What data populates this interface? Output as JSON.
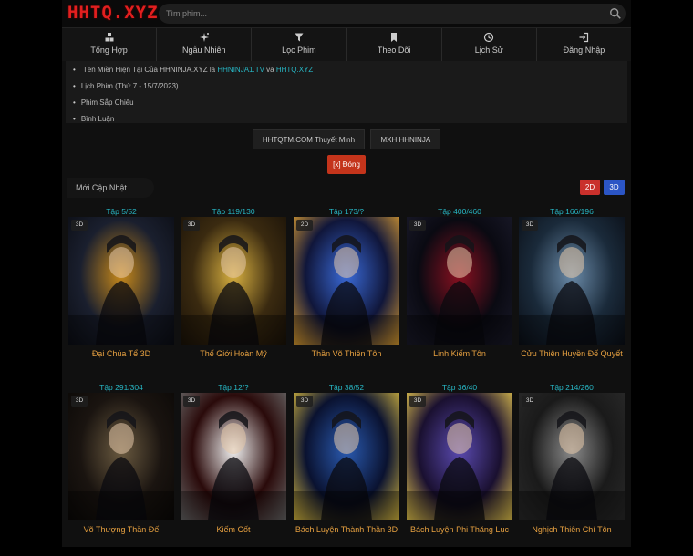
{
  "header": {
    "logo": "HHTQ.XYZ",
    "search_placeholder": "Tìm phim..."
  },
  "nav": [
    {
      "label": "Tổng Hợp",
      "icon": "cubes-icon"
    },
    {
      "label": "Ngẫu Nhiên",
      "icon": "sparkle-icon"
    },
    {
      "label": "Lọc Phim",
      "icon": "filter-icon"
    },
    {
      "label": "Theo Dõi",
      "icon": "bookmark-icon"
    },
    {
      "label": "Lịch Sử",
      "icon": "history-icon"
    },
    {
      "label": "Đăng Nhập",
      "icon": "login-icon"
    }
  ],
  "info": {
    "line1_prefix": "Tên Miền Hiện Tại Của HHNINJA.XYZ là",
    "line1_link1": "HHNINJA1.TV",
    "line1_and": "và",
    "line1_link2": "HHTQ.XYZ",
    "line2": "Lịch Phim (Thứ 7 - 15/7/2023)",
    "line3": "Phim Sắp Chiếu",
    "line4": "Bình Luận"
  },
  "buttons": {
    "hhtqtm": "HHTQTM.COM Thuyết Minh",
    "mxh": "MXH HHNINJA",
    "close": "[x] Đóng"
  },
  "section": {
    "title": "Mới Cập Nhật",
    "tag_2d": "2D",
    "tag_3d": "3D"
  },
  "colors": {
    "accent_teal": "#27b6c4",
    "title_orange": "#e6a040",
    "logo_red": "#e21f1f",
    "close_red": "#c4341b",
    "tag_blue": "#2b55c5"
  },
  "movies": [
    {
      "episode": "Tập 5/52",
      "dim": "3D",
      "title": "Đại Chúa Tể 3D"
    },
    {
      "episode": "Tập 119/130",
      "dim": "3D",
      "title": "Thế Giới Hoàn Mỹ"
    },
    {
      "episode": "Tập 173/?",
      "dim": "2D",
      "title": "Thần Võ Thiên Tôn"
    },
    {
      "episode": "Tập 400/460",
      "dim": "3D",
      "title": "Linh Kiếm Tôn"
    },
    {
      "episode": "Tập 166/196",
      "dim": "3D",
      "title": "Cửu Thiên Huyền Đế Quyết"
    },
    {
      "episode": "Tập 291/304",
      "dim": "3D",
      "title": "Võ Thượng Thần Đế"
    },
    {
      "episode": "Tập 12/?",
      "dim": "3D",
      "title": "Kiếm Cốt"
    },
    {
      "episode": "Tập 38/52",
      "dim": "3D",
      "title": "Bách Luyện Thành Thần 3D"
    },
    {
      "episode": "Tập 36/40",
      "dim": "3D",
      "title": "Bách Luyện Phi Thăng Lục"
    },
    {
      "episode": "Tập 214/260",
      "dim": "3D",
      "title": "Nghịch Thiên Chí Tôn"
    }
  ]
}
